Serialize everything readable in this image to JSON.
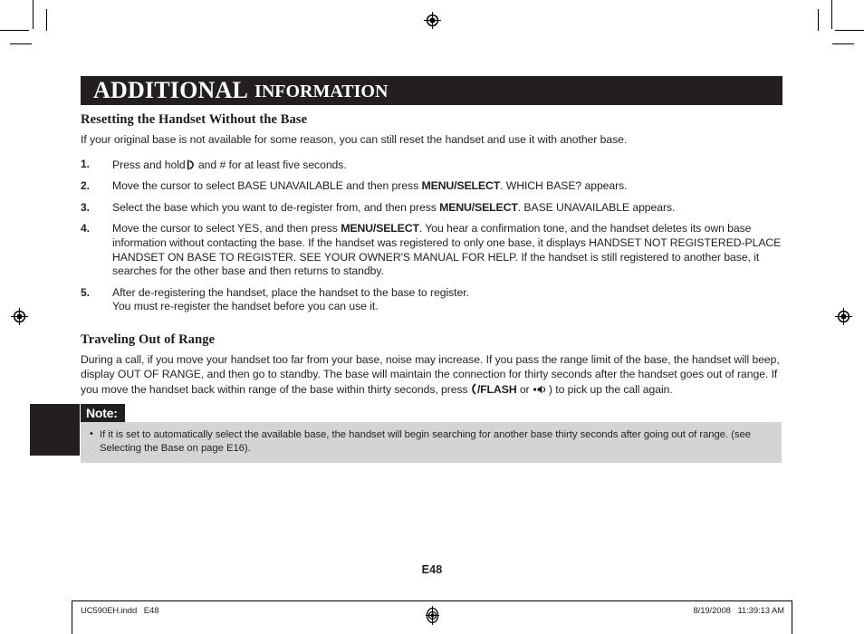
{
  "header": {
    "title_strong": "ADDITIONAL",
    "title_light": "INFORMATION"
  },
  "section1": {
    "heading": "Resetting the Handset Without the Base",
    "intro": "If your original base is not available for some reason, you can still reset the handset and use it with another base.",
    "steps": [
      {
        "number": "1.",
        "text_before": "Press and hold",
        "icon": "talk-phone-icon",
        "text_after": " and # for at least five seconds."
      },
      {
        "number": "2.",
        "text_before": "Move the cursor to select BASE UNAVAILABLE and then press ",
        "key": "MENU/SELECT",
        "text_after": ". WHICH BASE? appears."
      },
      {
        "number": "3.",
        "text_before": "Select the base which you want to de-register from, and then press ",
        "key": "MENU/SELECT",
        "text_after": ". BASE UNAVAILABLE appears."
      },
      {
        "number": "4.",
        "text_before": "Move the cursor to select YES, and then press ",
        "key": "MENU/SELECT",
        "text_after": ". You hear a confirmation tone, and the handset deletes its own base information without contacting the base. If the handset was registered to only one base, it displays HANDSET NOT REGISTERED-PLACE HANDSET ON BASE TO REGISTER. SEE YOUR OWNER'S MANUAL FOR HELP. If the handset is still registered to another base, it searches for the other base and then returns to standby."
      },
      {
        "number": "5.",
        "text_before": "After de-registering the handset, place the handset to the base to register.",
        "text_after": "You must re-register the handset before you can use it."
      }
    ]
  },
  "section2": {
    "heading": "Traveling Out of Range",
    "paragraph_part1": "During a call, if you move your handset too far from your base, noise may increase. If you pass the range limit of the base, the handset will beep, display OUT OF RANGE, and then go to standby. The base will maintain the connection for thirty seconds after the handset goes out of range. If you move the handset back within range of the base within thirty seconds, press ",
    "flash_key": "/FLASH",
    "paragraph_part2": " or ",
    "speaker_icon": "speaker-icon",
    "paragraph_part3": ") to pick up the call again."
  },
  "note": {
    "label": "Note:",
    "items": [
      "If it is set to automatically select the available base, the handset will begin searching for another base thirty seconds after going out of range. (see Selecting the Base on page E16)."
    ]
  },
  "page_number": "E48",
  "footer": {
    "slug_left": "UC590EH.indd   E48",
    "slug_right": "8/19/2008   11:39:13 AM"
  },
  "colors": {
    "ink": "#231f20",
    "note_background": "#d4d4d4",
    "paper": "#ffffff"
  }
}
